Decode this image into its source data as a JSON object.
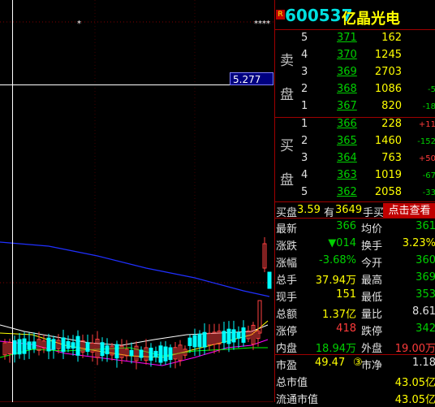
{
  "header": {
    "badge": "R",
    "code": "600537",
    "name": "亿晶光电"
  },
  "chart": {
    "crosshair_price": "5.277",
    "markers": [
      "*",
      "****"
    ],
    "colors": {
      "ma_blue": "#2030ff",
      "ma_white": "#ffffff",
      "ma_yellow": "#ffff00",
      "ma_magenta": "#ff00ff",
      "ma_green": "#00ff00",
      "up": "#ff4040",
      "down": "#00ffff"
    }
  },
  "sell": {
    "label_top": "卖",
    "label_bottom": "盘",
    "rows": [
      {
        "level": "5",
        "price": "371",
        "vol": "162",
        "chg": ""
      },
      {
        "level": "4",
        "price": "370",
        "vol": "1245",
        "chg": ""
      },
      {
        "level": "3",
        "price": "369",
        "vol": "2703",
        "chg": ""
      },
      {
        "level": "2",
        "price": "368",
        "vol": "1086",
        "chg": "-5"
      },
      {
        "level": "1",
        "price": "367",
        "vol": "820",
        "chg": "-18"
      }
    ]
  },
  "buy": {
    "label_top": "买",
    "label_bottom": "盘",
    "rows": [
      {
        "level": "1",
        "price": "366",
        "vol": "228",
        "chg": "+11"
      },
      {
        "level": "2",
        "price": "365",
        "vol": "1460",
        "chg": "-152"
      },
      {
        "level": "3",
        "price": "364",
        "vol": "763",
        "chg": "+50"
      },
      {
        "level": "4",
        "price": "363",
        "vol": "1019",
        "chg": "-67"
      },
      {
        "level": "5",
        "price": "362",
        "vol": "2058",
        "chg": "-33"
      }
    ]
  },
  "buyline": {
    "prefix": "买盘",
    "v1": "3.59",
    "mid": "有",
    "v2": "3649",
    "suffix": "手买",
    "button": "点击查看"
  },
  "stats": [
    {
      "l1": "最新",
      "v1": "366",
      "l2": "均价",
      "v2": "361"
    },
    {
      "l1": "涨跌",
      "v1": "▼014",
      "l2": "换手",
      "v2": "3.23%"
    },
    {
      "l1": "涨幅",
      "v1": "-3.68%",
      "l2": "今开",
      "v2": "360"
    },
    {
      "l1": "总手",
      "v1": "37.94万",
      "l2": "最高",
      "v2": "369"
    },
    {
      "l1": "现手",
      "v1": "151",
      "l2": "最低",
      "v2": "353"
    },
    {
      "l1": "总额",
      "v1": "1.37亿",
      "l2": "量比",
      "v2": "8.61"
    },
    {
      "l1": "涨停",
      "v1": "418",
      "l2": "跌停",
      "v2": "342"
    },
    {
      "l1": "内盘",
      "v1": "18.94万",
      "l2": "外盘",
      "v2": "19.00万"
    }
  ],
  "valuation": [
    {
      "l1": "市盈",
      "v1": "49.47",
      "badge": "③",
      "l2": "市净",
      "v2": "1.18"
    },
    {
      "l1": "总市值",
      "v1": "43.05亿"
    },
    {
      "l1": "流通市值",
      "v1": "43.05亿"
    }
  ]
}
